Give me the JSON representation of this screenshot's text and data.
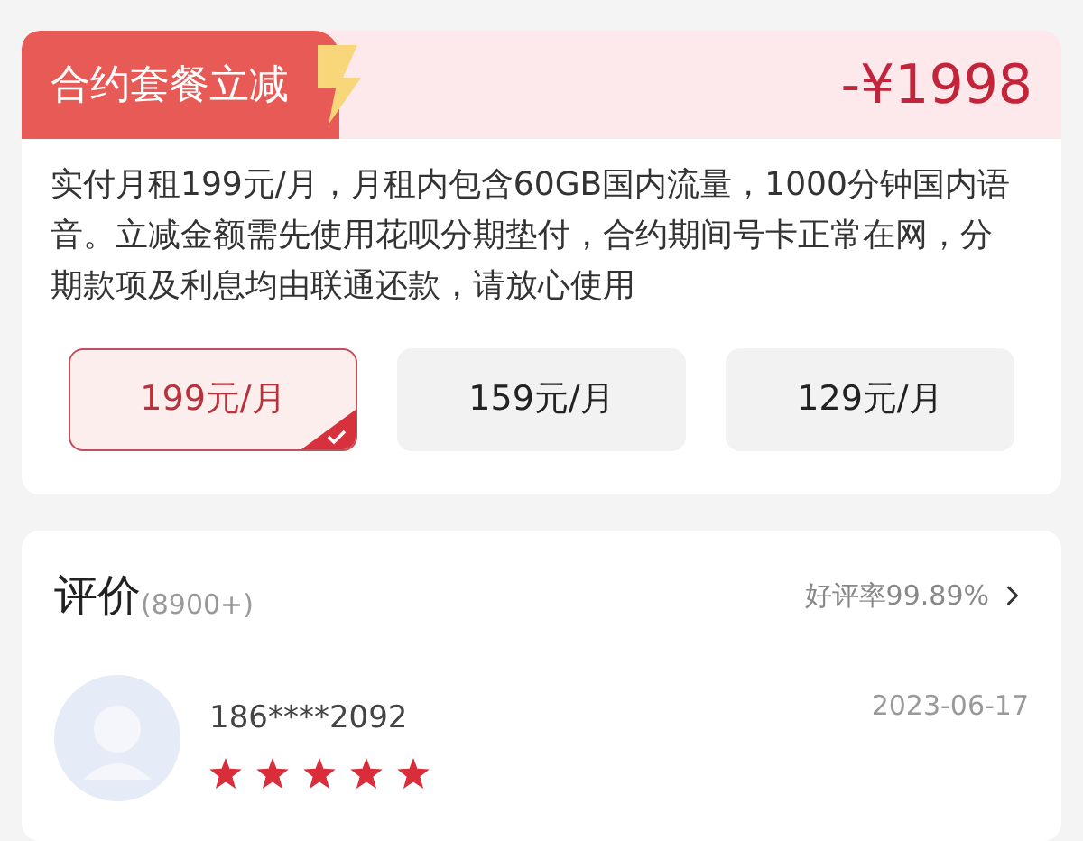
{
  "promo": {
    "tag": "合约套餐立减",
    "discount": "-¥1998",
    "description": "实付月租199元/月，月租内包含60GB国内流量，1000分钟国内语音。立减金额需先使用花呗分期垫付，合约期间号卡正常在网，分期款项及利息均由联通还款，请放心使用"
  },
  "plans": [
    {
      "label": "199元/月",
      "selected": true
    },
    {
      "label": "159元/月",
      "selected": false
    },
    {
      "label": "129元/月",
      "selected": false
    }
  ],
  "reviews": {
    "title": "评价",
    "count": "(8900+)",
    "rating": "好评率99.89%",
    "items": [
      {
        "user": "186****2092",
        "date": "2023-06-17",
        "stars": 5
      }
    ]
  }
}
